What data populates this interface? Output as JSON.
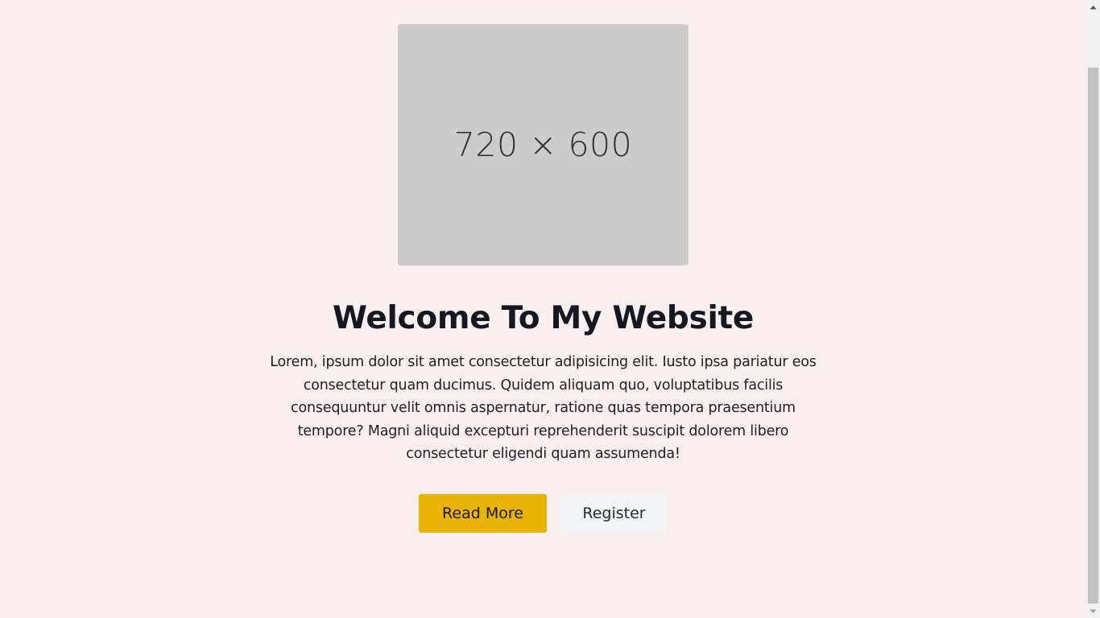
{
  "hero": {
    "image_placeholder": "720 × 600",
    "title": "Welcome To My Website",
    "description": "Lorem, ipsum dolor sit amet consectetur adipisicing elit. Iusto ipsa pariatur eos consectetur quam ducimus. Quidem aliquam quo, voluptatibus facilis consequuntur velit omnis aspernatur, ratione quas tempora praesentium tempore? Magni aliquid excepturi reprehenderit suscipit dolorem libero consectetur eligendi quam assumenda!",
    "primary_button": "Read More",
    "secondary_button": "Register"
  },
  "colors": {
    "background": "#f9efee",
    "primary_button": "#e9b308",
    "secondary_button": "#f3f4f6",
    "image_placeholder": "#cccccc"
  },
  "scrollbar": {
    "up_icon": "chevron-up-icon",
    "down_icon": "chevron-down-icon"
  }
}
